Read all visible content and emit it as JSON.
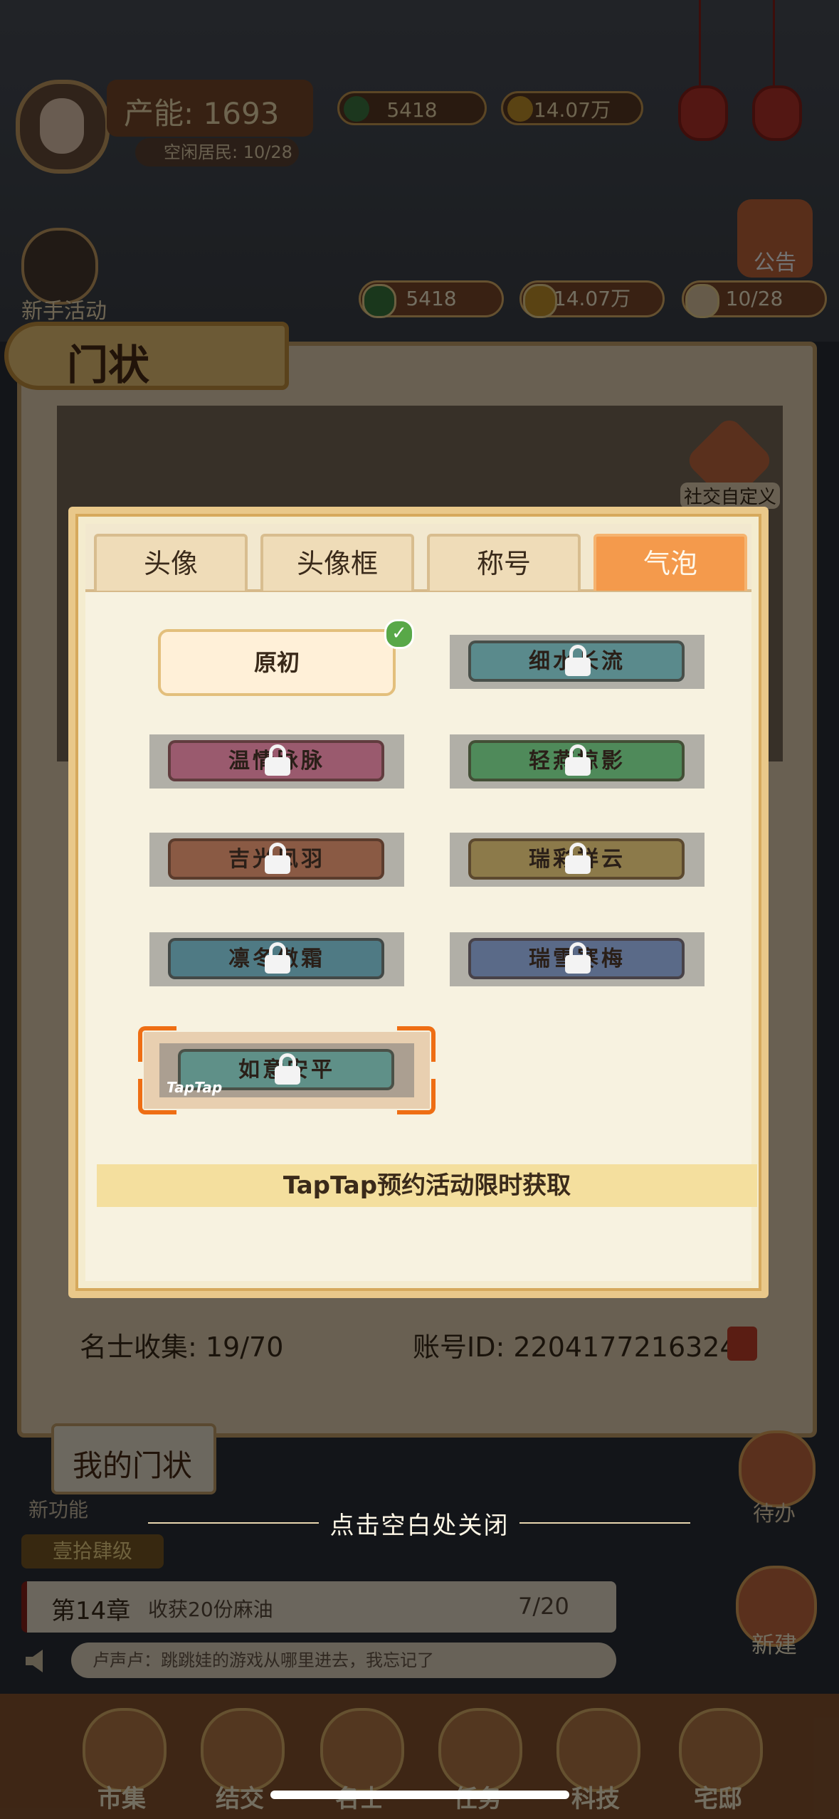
{
  "background": {
    "top_production": "产能: 1693",
    "top_resident": "空闲居民: 10/28",
    "top_coins": "5418",
    "top_money": "14.07万",
    "newbie_label": "新手活动",
    "notice_label": "公告",
    "currency_green": "5418",
    "currency_gold": "14.07万",
    "currency_resident": "10/28",
    "header_title": "门状",
    "social_custom": "社交自定义",
    "stat_collect": "名士收集: 19/70",
    "stat_account": "账号ID: 22041772163249",
    "my_card_tab": "我的门状",
    "new_feature": "新功能",
    "todo_label": "待办",
    "level_badge": "壹拾肆级",
    "quest_chapter": "第14章",
    "quest_desc": "收获20份麻油",
    "quest_progress": "7/20",
    "ticker_text": "卢声卢：跳跳娃的游戏从哪里进去，我忘记了",
    "build_label": "新建",
    "nav": [
      "市集",
      "结交",
      "名士",
      "任务",
      "科技",
      "宅邸"
    ]
  },
  "modal": {
    "tabs": [
      "头像",
      "头像框",
      "称号",
      "气泡"
    ],
    "active_tab": "气泡",
    "bubbles": [
      {
        "label": "原初",
        "locked": false,
        "selected": true
      },
      {
        "label": "细水长流",
        "locked": true,
        "color": "#5a8a8c"
      },
      {
        "label": "温情脉脉",
        "locked": true,
        "color": "#9a5a6e"
      },
      {
        "label": "轻燕掠影",
        "locked": true,
        "color": "#4f8a5a"
      },
      {
        "label": "吉光凤羽",
        "locked": true,
        "color": "#8a5a44"
      },
      {
        "label": "瑞彩祥云",
        "locked": true,
        "color": "#8c7a4a"
      },
      {
        "label": "凛冬傲霜",
        "locked": true,
        "color": "#4f7a84"
      },
      {
        "label": "瑞雪寒梅",
        "locked": true,
        "color": "#5a6a88"
      },
      {
        "label": "如意安平",
        "locked": true,
        "color": "#5f9088",
        "tag": "TapTap"
      }
    ],
    "info_text": "TapTap预约活动限时获取"
  },
  "close_hint": "点击空白处关闭"
}
